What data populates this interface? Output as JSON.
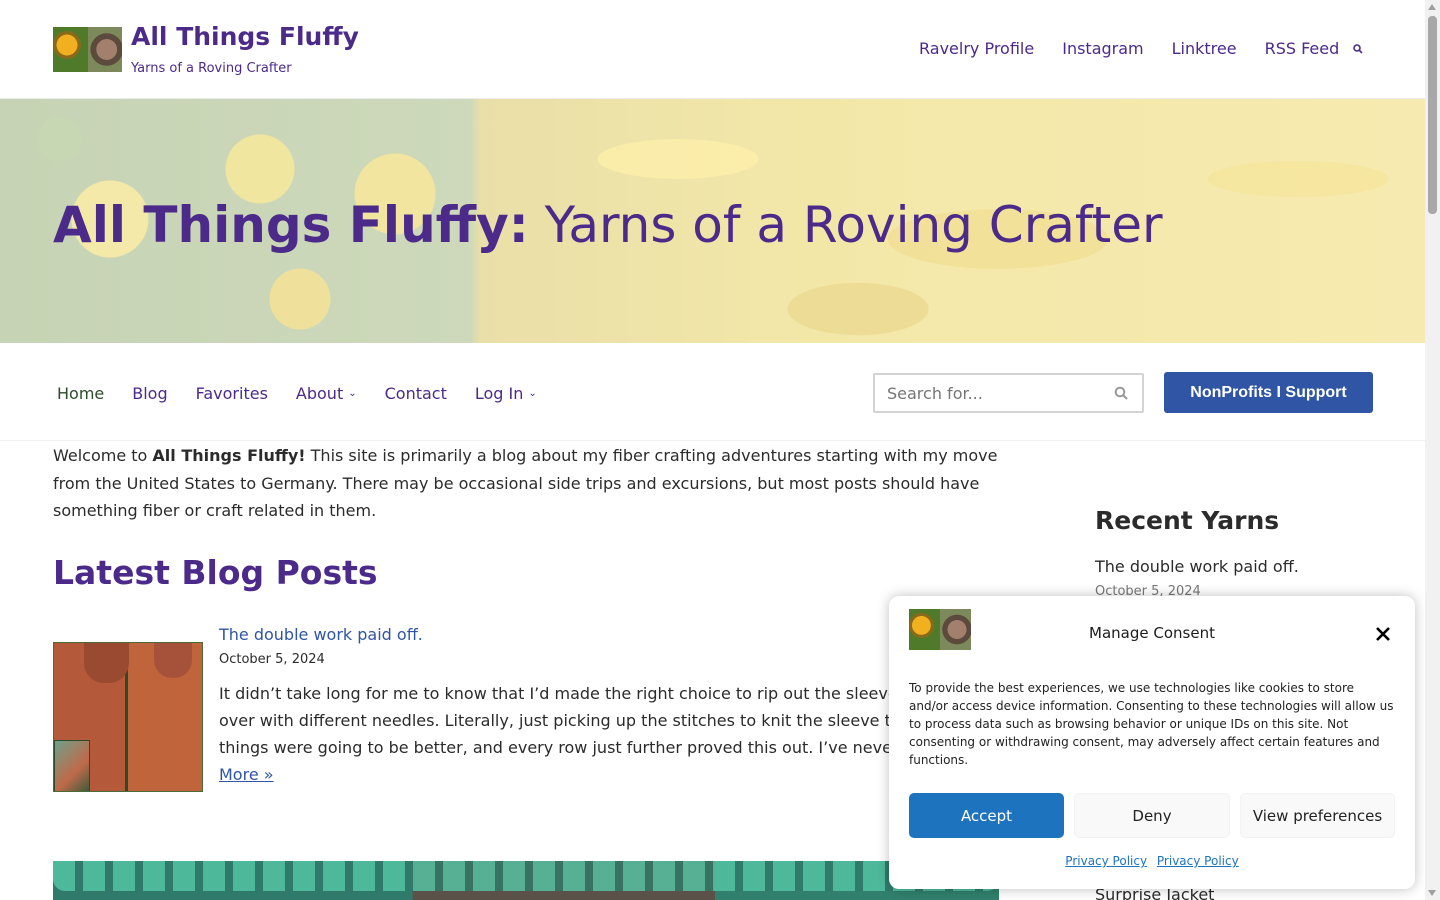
{
  "header": {
    "site_title": "All Things Fluffy",
    "tagline": "Yarns of a Roving Crafter",
    "nav": [
      "Ravelry Profile",
      "Instagram",
      "Linktree",
      "RSS Feed"
    ]
  },
  "hero": {
    "title_bold": "All Things Fluffy:",
    "title_rest": " Yarns of a Roving Crafter"
  },
  "subnav": {
    "items": [
      "Home",
      "Blog",
      "Favorites",
      "About",
      "Contact",
      "Log In"
    ],
    "search_placeholder": "Search for...",
    "nonprofits_label": "NonProfits I Support"
  },
  "content": {
    "intro_pre": "Welcome to ",
    "intro_bold": "All Things Fluffy!",
    "intro_post": " This site is primarily a blog about my fiber crafting adventures starting with my move from the United States to Germany. There may be occasional side trips and excursions, but most posts should have something fiber or craft related in them.",
    "latest_title": "Latest Blog Posts",
    "post": {
      "title": "The double work paid off.",
      "date": "October 5, 2024",
      "excerpt": "It didn’t take long for me to know that I’d made the right choice to rip out the sleeve and start over with different needles. Literally, just picking up the stitches to knit the sleeve told me things were going to be better, and every row just further proved this out. I’ve never used …",
      "more": "More »"
    }
  },
  "sidebar": {
    "title": "Recent Yarns",
    "items": [
      {
        "title": "The double work paid off.",
        "date": "October 5, 2024"
      },
      {
        "title": "Surprise Jacket"
      }
    ]
  },
  "consent": {
    "title": "Manage Consent",
    "text": "To provide the best experiences, we use technologies like cookies to store and/or access device information. Consenting to these technologies will allow us to process data such as browsing behavior or unique IDs on this site. Not consenting or withdrawing consent, may adversely affect certain features and functions.",
    "accept": "Accept",
    "deny": "Deny",
    "preferences": "View preferences",
    "links": [
      "Privacy Policy",
      "Privacy Policy"
    ]
  },
  "colors": {
    "brand_purple": "#4b2a8a",
    "link_blue": "#2f55a4",
    "accept_blue": "#1e73be"
  }
}
